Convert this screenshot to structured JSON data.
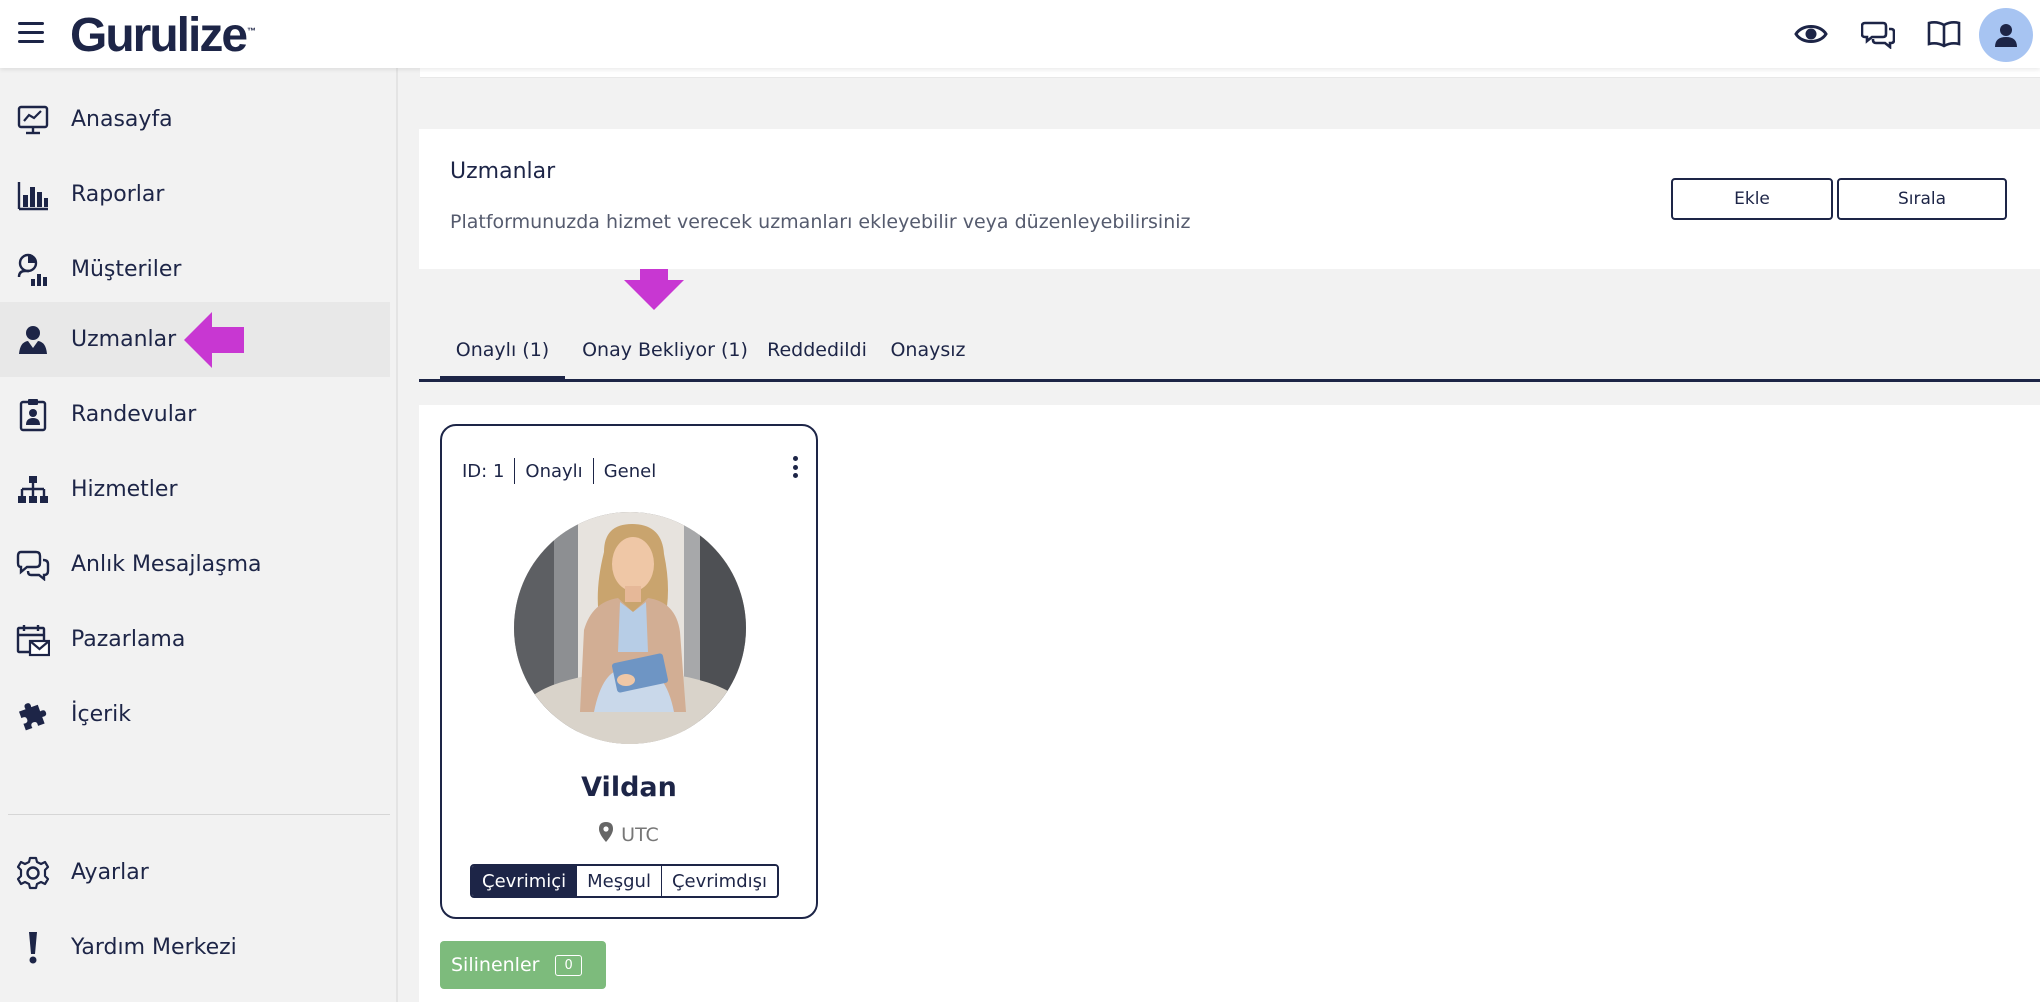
{
  "app": {
    "logo": "Gurulize",
    "logo_mark": "™"
  },
  "topbar": {
    "icons": [
      "eye-icon",
      "chat-bubbles-icon",
      "book-icon",
      "user-avatar-icon"
    ]
  },
  "sidebar": {
    "items": [
      {
        "label": "Anasayfa",
        "icon": "monitor-chart-icon"
      },
      {
        "label": "Raporlar",
        "icon": "bar-chart-icon"
      },
      {
        "label": "Müşteriler",
        "icon": "customers-icon"
      },
      {
        "label": "Uzmanlar",
        "icon": "expert-user-icon",
        "active": true
      },
      {
        "label": "Randevular",
        "icon": "clipboard-user-icon"
      },
      {
        "label": "Hizmetler",
        "icon": "hierarchy-icon"
      },
      {
        "label": "Anlık Mesajlaşma",
        "icon": "chat-icon"
      },
      {
        "label": "Pazarlama",
        "icon": "calendar-mail-icon"
      },
      {
        "label": "İçerik",
        "icon": "puzzle-icon"
      }
    ],
    "bottom_items": [
      {
        "label": "Ayarlar",
        "icon": "gear-icon"
      },
      {
        "label": "Yardım Merkezi",
        "icon": "exclamation-icon"
      }
    ]
  },
  "header": {
    "title": "Uzmanlar",
    "description": "Platformunuzda hizmet verecek uzmanları ekleyebilir veya düzenleyebilirsiniz",
    "add_label": "Ekle",
    "sort_label": "Sırala"
  },
  "tabs": [
    {
      "label": "Onaylı (1)",
      "active": true
    },
    {
      "label": "Onay Bekliyor (1)"
    },
    {
      "label": "Reddedildi"
    },
    {
      "label": "Onaysız"
    }
  ],
  "expert_card": {
    "id": "ID: 1",
    "status": "Onaylı",
    "category": "Genel",
    "name": "Vildan",
    "location": "UTC",
    "availability": [
      "Çevrimiçi",
      "Meşgul",
      "Çevrimdışı"
    ],
    "availability_selected": "Çevrimiçi"
  },
  "deleted": {
    "label": "Silinenler",
    "count": "0"
  },
  "colors": {
    "primary": "#1d2547",
    "highlight_arrow": "#c837d2",
    "deleted_button": "#7dbb7c",
    "avatar_bg": "#a7c4f2"
  }
}
